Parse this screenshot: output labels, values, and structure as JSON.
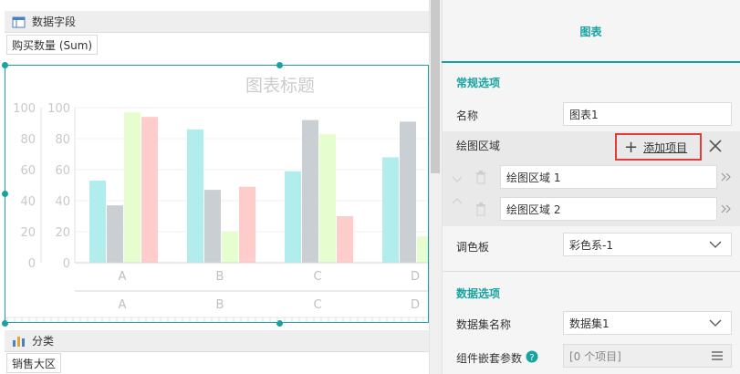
{
  "left": {
    "data_fields_label": "数据字段",
    "data_field_chip": "购买数量 (Sum)",
    "category_label": "分类",
    "category_chip": "销售大区"
  },
  "chart_data": {
    "type": "bar",
    "title": "图表标题",
    "categories": [
      "A",
      "B",
      "C",
      "D"
    ],
    "series": [
      {
        "color": "#b2eded",
        "values": [
          53,
          86,
          59,
          68
        ]
      },
      {
        "color": "#c9cfd3",
        "values": [
          37,
          47,
          92,
          91
        ]
      },
      {
        "color": "#e6fdd0",
        "values": [
          97,
          20,
          83,
          17
        ]
      },
      {
        "color": "#ffcccc",
        "values": [
          94,
          49,
          30,
          null
        ]
      }
    ],
    "ylim": [
      0,
      100
    ],
    "yticks": [
      0,
      20,
      40,
      60,
      80,
      100
    ],
    "yticks_left": [
      "0",
      "20",
      "40",
      "60",
      "80",
      "100"
    ],
    "yticks_inner": [
      "0",
      "20",
      "40",
      "60",
      "80",
      "100"
    ],
    "xticks_top": [
      "A",
      "B",
      "C",
      "D"
    ],
    "xticks_bottom": [
      "A",
      "B",
      "C",
      "D"
    ]
  },
  "panel": {
    "tab_title": "图表",
    "general_section": "常规选项",
    "name_label": "名称",
    "name_value": "图表1",
    "plot_area_label": "绘图区域",
    "add_item_label": "添加项目",
    "plot_areas": [
      "绘图区域 1",
      "绘图区域 2"
    ],
    "palette_label": "调色板",
    "palette_value": "彩色系-1",
    "data_section": "数据选项",
    "dataset_label": "数据集名称",
    "dataset_value": "数据集1",
    "nested_label": "组件嵌套参数",
    "nested_value": "[0 个项目]"
  },
  "colors": {
    "accent": "#16a3a1",
    "highlight": "#e23b3b"
  }
}
